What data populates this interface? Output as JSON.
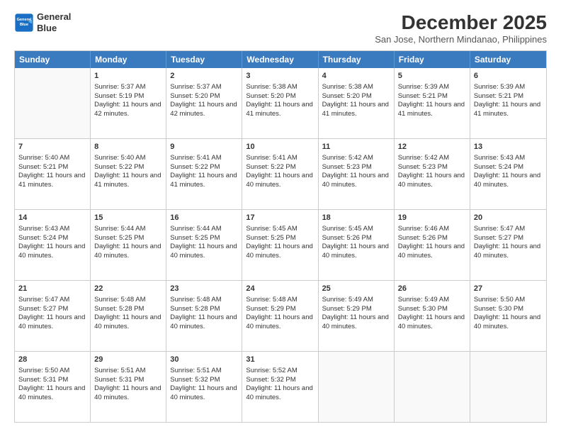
{
  "logo": {
    "line1": "General",
    "line2": "Blue"
  },
  "title": "December 2025",
  "location": "San Jose, Northern Mindanao, Philippines",
  "days_of_week": [
    "Sunday",
    "Monday",
    "Tuesday",
    "Wednesday",
    "Thursday",
    "Friday",
    "Saturday"
  ],
  "weeks": [
    [
      {
        "day": "",
        "sunrise": "",
        "sunset": "",
        "daylight": ""
      },
      {
        "day": "1",
        "sunrise": "Sunrise: 5:37 AM",
        "sunset": "Sunset: 5:19 PM",
        "daylight": "Daylight: 11 hours and 42 minutes."
      },
      {
        "day": "2",
        "sunrise": "Sunrise: 5:37 AM",
        "sunset": "Sunset: 5:20 PM",
        "daylight": "Daylight: 11 hours and 42 minutes."
      },
      {
        "day": "3",
        "sunrise": "Sunrise: 5:38 AM",
        "sunset": "Sunset: 5:20 PM",
        "daylight": "Daylight: 11 hours and 41 minutes."
      },
      {
        "day": "4",
        "sunrise": "Sunrise: 5:38 AM",
        "sunset": "Sunset: 5:20 PM",
        "daylight": "Daylight: 11 hours and 41 minutes."
      },
      {
        "day": "5",
        "sunrise": "Sunrise: 5:39 AM",
        "sunset": "Sunset: 5:21 PM",
        "daylight": "Daylight: 11 hours and 41 minutes."
      },
      {
        "day": "6",
        "sunrise": "Sunrise: 5:39 AM",
        "sunset": "Sunset: 5:21 PM",
        "daylight": "Daylight: 11 hours and 41 minutes."
      }
    ],
    [
      {
        "day": "7",
        "sunrise": "Sunrise: 5:40 AM",
        "sunset": "Sunset: 5:21 PM",
        "daylight": "Daylight: 11 hours and 41 minutes."
      },
      {
        "day": "8",
        "sunrise": "Sunrise: 5:40 AM",
        "sunset": "Sunset: 5:22 PM",
        "daylight": "Daylight: 11 hours and 41 minutes."
      },
      {
        "day": "9",
        "sunrise": "Sunrise: 5:41 AM",
        "sunset": "Sunset: 5:22 PM",
        "daylight": "Daylight: 11 hours and 41 minutes."
      },
      {
        "day": "10",
        "sunrise": "Sunrise: 5:41 AM",
        "sunset": "Sunset: 5:22 PM",
        "daylight": "Daylight: 11 hours and 40 minutes."
      },
      {
        "day": "11",
        "sunrise": "Sunrise: 5:42 AM",
        "sunset": "Sunset: 5:23 PM",
        "daylight": "Daylight: 11 hours and 40 minutes."
      },
      {
        "day": "12",
        "sunrise": "Sunrise: 5:42 AM",
        "sunset": "Sunset: 5:23 PM",
        "daylight": "Daylight: 11 hours and 40 minutes."
      },
      {
        "day": "13",
        "sunrise": "Sunrise: 5:43 AM",
        "sunset": "Sunset: 5:24 PM",
        "daylight": "Daylight: 11 hours and 40 minutes."
      }
    ],
    [
      {
        "day": "14",
        "sunrise": "Sunrise: 5:43 AM",
        "sunset": "Sunset: 5:24 PM",
        "daylight": "Daylight: 11 hours and 40 minutes."
      },
      {
        "day": "15",
        "sunrise": "Sunrise: 5:44 AM",
        "sunset": "Sunset: 5:25 PM",
        "daylight": "Daylight: 11 hours and 40 minutes."
      },
      {
        "day": "16",
        "sunrise": "Sunrise: 5:44 AM",
        "sunset": "Sunset: 5:25 PM",
        "daylight": "Daylight: 11 hours and 40 minutes."
      },
      {
        "day": "17",
        "sunrise": "Sunrise: 5:45 AM",
        "sunset": "Sunset: 5:25 PM",
        "daylight": "Daylight: 11 hours and 40 minutes."
      },
      {
        "day": "18",
        "sunrise": "Sunrise: 5:45 AM",
        "sunset": "Sunset: 5:26 PM",
        "daylight": "Daylight: 11 hours and 40 minutes."
      },
      {
        "day": "19",
        "sunrise": "Sunrise: 5:46 AM",
        "sunset": "Sunset: 5:26 PM",
        "daylight": "Daylight: 11 hours and 40 minutes."
      },
      {
        "day": "20",
        "sunrise": "Sunrise: 5:47 AM",
        "sunset": "Sunset: 5:27 PM",
        "daylight": "Daylight: 11 hours and 40 minutes."
      }
    ],
    [
      {
        "day": "21",
        "sunrise": "Sunrise: 5:47 AM",
        "sunset": "Sunset: 5:27 PM",
        "daylight": "Daylight: 11 hours and 40 minutes."
      },
      {
        "day": "22",
        "sunrise": "Sunrise: 5:48 AM",
        "sunset": "Sunset: 5:28 PM",
        "daylight": "Daylight: 11 hours and 40 minutes."
      },
      {
        "day": "23",
        "sunrise": "Sunrise: 5:48 AM",
        "sunset": "Sunset: 5:28 PM",
        "daylight": "Daylight: 11 hours and 40 minutes."
      },
      {
        "day": "24",
        "sunrise": "Sunrise: 5:48 AM",
        "sunset": "Sunset: 5:29 PM",
        "daylight": "Daylight: 11 hours and 40 minutes."
      },
      {
        "day": "25",
        "sunrise": "Sunrise: 5:49 AM",
        "sunset": "Sunset: 5:29 PM",
        "daylight": "Daylight: 11 hours and 40 minutes."
      },
      {
        "day": "26",
        "sunrise": "Sunrise: 5:49 AM",
        "sunset": "Sunset: 5:30 PM",
        "daylight": "Daylight: 11 hours and 40 minutes."
      },
      {
        "day": "27",
        "sunrise": "Sunrise: 5:50 AM",
        "sunset": "Sunset: 5:30 PM",
        "daylight": "Daylight: 11 hours and 40 minutes."
      }
    ],
    [
      {
        "day": "28",
        "sunrise": "Sunrise: 5:50 AM",
        "sunset": "Sunset: 5:31 PM",
        "daylight": "Daylight: 11 hours and 40 minutes."
      },
      {
        "day": "29",
        "sunrise": "Sunrise: 5:51 AM",
        "sunset": "Sunset: 5:31 PM",
        "daylight": "Daylight: 11 hours and 40 minutes."
      },
      {
        "day": "30",
        "sunrise": "Sunrise: 5:51 AM",
        "sunset": "Sunset: 5:32 PM",
        "daylight": "Daylight: 11 hours and 40 minutes."
      },
      {
        "day": "31",
        "sunrise": "Sunrise: 5:52 AM",
        "sunset": "Sunset: 5:32 PM",
        "daylight": "Daylight: 11 hours and 40 minutes."
      },
      {
        "day": "",
        "sunrise": "",
        "sunset": "",
        "daylight": ""
      },
      {
        "day": "",
        "sunrise": "",
        "sunset": "",
        "daylight": ""
      },
      {
        "day": "",
        "sunrise": "",
        "sunset": "",
        "daylight": ""
      }
    ]
  ]
}
